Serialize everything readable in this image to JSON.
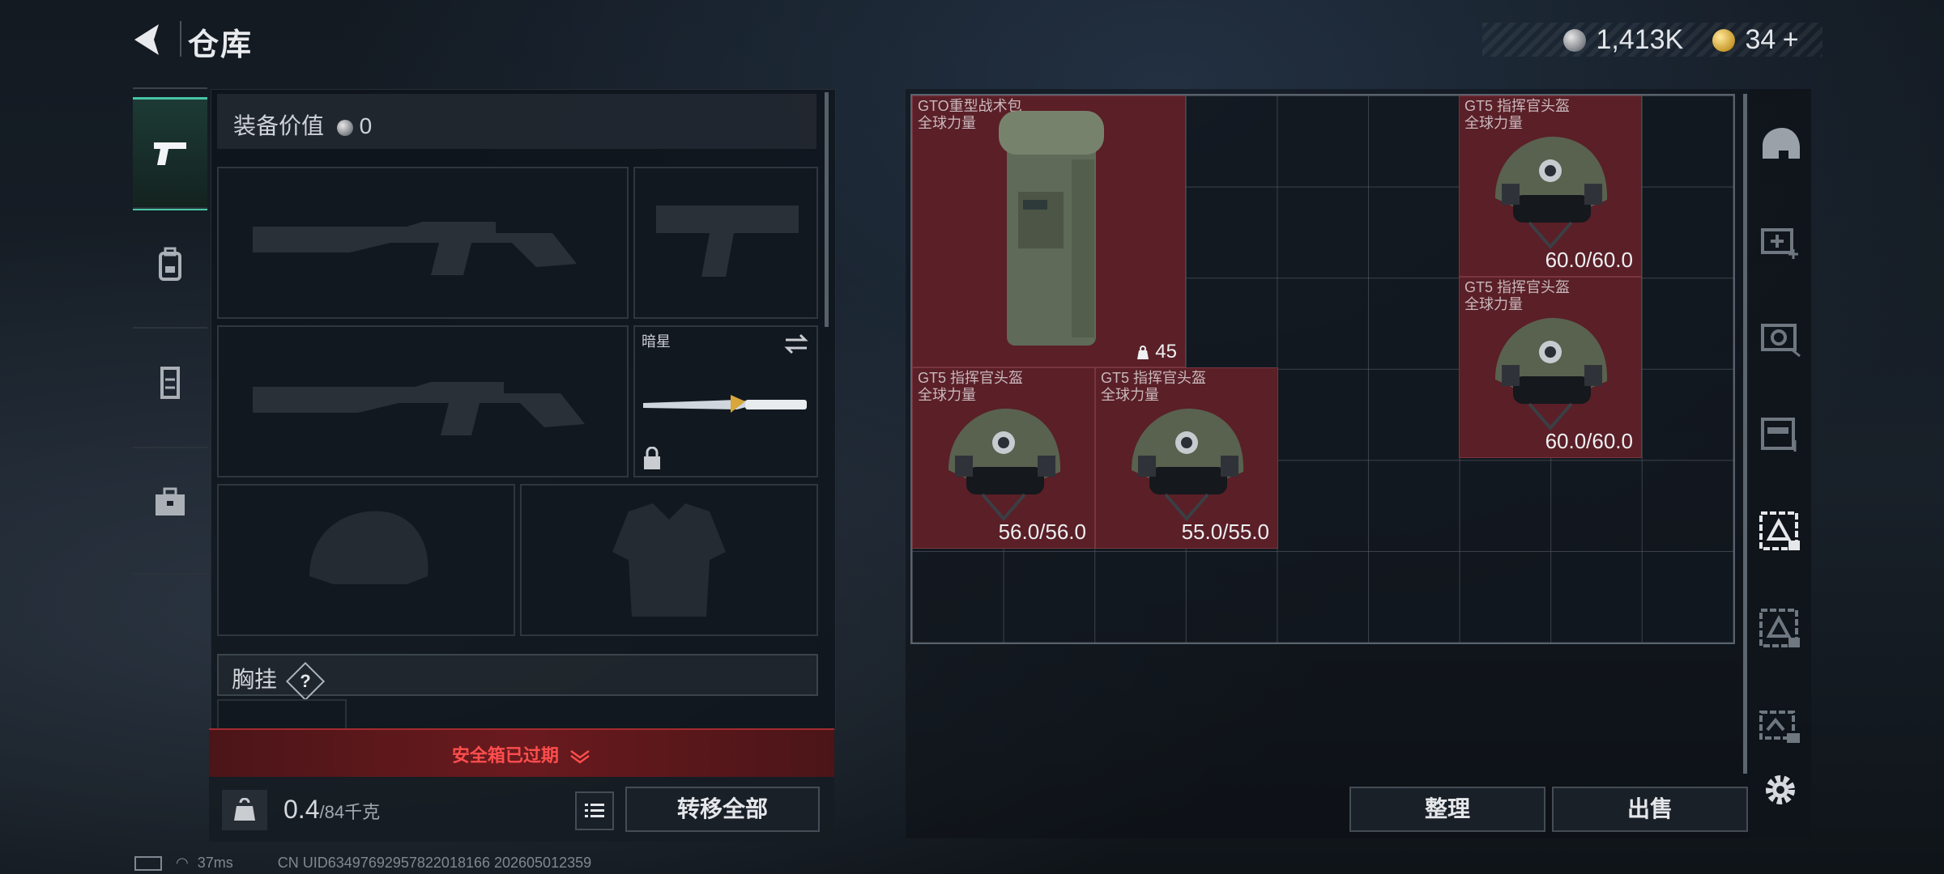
{
  "header": {
    "title": "仓库"
  },
  "currency": {
    "silver": "1,413K",
    "gold": "34",
    "gold_plus": "+"
  },
  "equipment": {
    "value_label": "装备价值",
    "value": "0",
    "melee_slot_label": "暗星",
    "vest_label": "胸挂",
    "help_symbol": "?"
  },
  "safe_box": {
    "status": "安全箱已过期"
  },
  "weight": {
    "current": "0.4",
    "max": "/84千克"
  },
  "buttons": {
    "transfer_all": "转移全部",
    "sort": "整理",
    "sell": "出售"
  },
  "stash_items": [
    {
      "name": "GTO重型战术包",
      "maker": "全球力量",
      "value": "45",
      "kind": "backpack"
    },
    {
      "name": "GT5 指挥官头盔",
      "maker": "全球力量",
      "value": "60.0/60.0",
      "kind": "helmet"
    },
    {
      "name": "GT5 指挥官头盔",
      "maker": "全球力量",
      "value": "60.0/60.0",
      "kind": "helmet"
    },
    {
      "name": "GT5 指挥官头盔",
      "maker": "全球力量",
      "value": "56.0/56.0",
      "kind": "helmet"
    },
    {
      "name": "GT5 指挥官头盔",
      "maker": "全球力量",
      "value": "55.0/55.0",
      "kind": "helmet"
    }
  ],
  "status_bar": {
    "ping": "37ms",
    "uid": "CN UID634976929578220181​66 202605012359"
  },
  "icons": {
    "left_tabs": [
      "pistol-icon",
      "backpack-icon",
      "vest-icon",
      "briefcase-icon"
    ],
    "right_tools": [
      "helmet-filter-icon",
      "medkit-filter-icon",
      "camera-filter-icon",
      "card-filter-icon",
      "crate-filter-icon",
      "crate-filter-icon-2",
      "crate-filter-icon-3",
      "settings-icon"
    ]
  },
  "colors": {
    "accent": "#46c6a5",
    "item_bg": "#5a1f27",
    "alert": "#ff4d4d"
  }
}
